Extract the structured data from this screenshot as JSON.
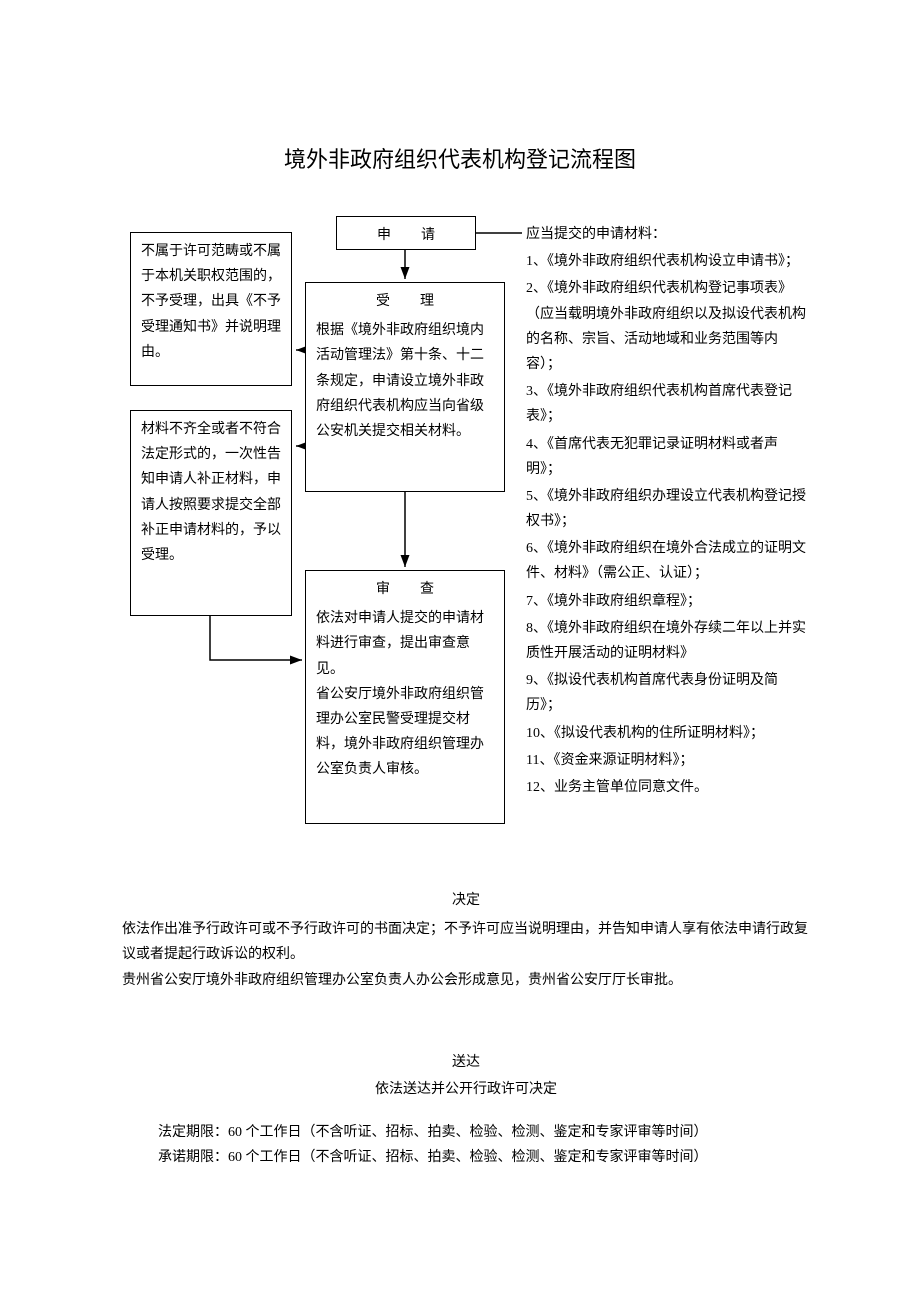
{
  "title": "境外非政府组织代表机构登记流程图",
  "flow": {
    "apply": {
      "title": "申　请"
    },
    "left1": "不属于许可范畴或不属于本机关职权范围的，不予受理，出具《不予受理通知书》并说明理由。",
    "accept": {
      "title": "受　理",
      "body": "根据《境外非政府组织境内活动管理法》第十条、十二条规定，申请设立境外非政府组织代表机构应当向省级公安机关提交相关材料。"
    },
    "left2": "材料不齐全或者不符合法定形式的，一次性告知申请人补正材料，申请人按照要求提交全部补正申请材料的，予以受理。",
    "review": {
      "title": "审　查",
      "body": "依法对申请人提交的申请材料进行审查，提出审查意见。\n省公安厅境外非政府组织管理办公室民警受理提交材料，境外非政府组织管理办公室负责人审核。"
    }
  },
  "materials": {
    "header": "应当提交的申请材料：",
    "items": [
      "1、《境外非政府组织代表机构设立申请书》；",
      "2、《境外非政府组织代表机构登记事项表》（应当载明境外非政府组织以及拟设代表机构的名称、宗旨、活动地域和业务范围等内容）；",
      "3、《境外非政府组织代表机构首席代表登记表》；",
      "4、《首席代表无犯罪记录证明材料或者声明》；",
      "5、《境外非政府组织办理设立代表机构登记授权书》；",
      "6、《境外非政府组织在境外合法成立的证明文件、材料》（需公正、认证）；",
      "7、《境外非政府组织章程》；",
      "8、《境外非政府组织在境外存续二年以上并实质性开展活动的证明材料》",
      "9、《拟设代表机构首席代表身份证明及简历》；",
      "10、《拟设代表机构的住所证明材料》；",
      "11、《资金来源证明材料》；",
      "12、业务主管单位同意文件。"
    ]
  },
  "decision": {
    "title": "决定",
    "body1": "依法作出准予行政许可或不予行政许可的书面决定；不予许可应当说明理由，并告知申请人享有依法申请行政复议或者提起行政诉讼的权利。",
    "body2": "贵州省公安厅境外非政府组织管理办公室负责人办公会形成意见，贵州省公安厅厅长审批。"
  },
  "deliver": {
    "title": "送达",
    "body": "依法送达并公开行政许可决定"
  },
  "deadlines": {
    "statutory": "法定期限：60 个工作日（不含听证、招标、拍卖、检验、检测、鉴定和专家评审等时间）",
    "commitment": "承诺期限：60 个工作日（不含听证、招标、拍卖、检验、检测、鉴定和专家评审等时间）"
  }
}
